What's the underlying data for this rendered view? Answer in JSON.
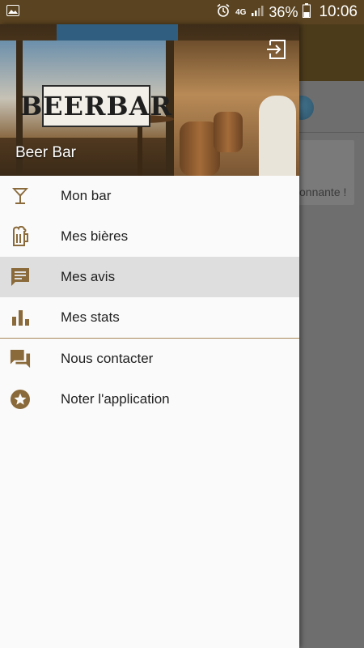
{
  "status_bar": {
    "network": "4G",
    "battery": "36%",
    "time": "10:06"
  },
  "background": {
    "card_text": "onnante !"
  },
  "drawer": {
    "header_title": "Beer Bar",
    "sign_text": "BEERBAR",
    "items": [
      {
        "label": "Mon bar",
        "icon": "cocktail-icon"
      },
      {
        "label": "Mes bières",
        "icon": "beer-mug-icon"
      },
      {
        "label": "Mes avis",
        "icon": "comment-icon",
        "selected": true
      },
      {
        "label": "Mes stats",
        "icon": "bar-chart-icon"
      },
      {
        "label": "Nous contacter",
        "icon": "forum-icon"
      },
      {
        "label": "Noter l'application",
        "icon": "star-circle-icon"
      }
    ]
  },
  "colors": {
    "accent": "#8a6a3a",
    "status_bar": "#5a4320",
    "selected_row": "#dedede"
  }
}
